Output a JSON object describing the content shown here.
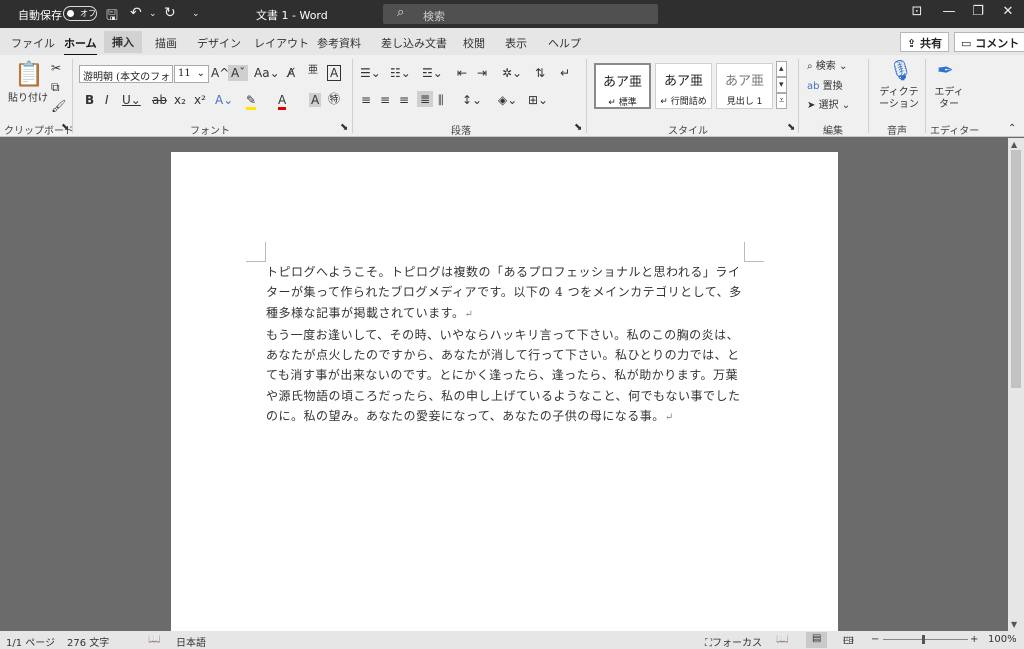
{
  "titlebar": {
    "autosave_label": "自動保存",
    "autosave_state": "オフ",
    "document_title": "文書 1  -  Word",
    "search_placeholder": "検索"
  },
  "tabs": [
    {
      "label": "ファイル"
    },
    {
      "label": "ホーム"
    },
    {
      "label": "挿入"
    },
    {
      "label": "描画"
    },
    {
      "label": "デザイン"
    },
    {
      "label": "レイアウト"
    },
    {
      "label": "参考資料"
    },
    {
      "label": "差し込み文書"
    },
    {
      "label": "校閲"
    },
    {
      "label": "表示"
    },
    {
      "label": "ヘルプ"
    }
  ],
  "tab_buttons": {
    "share": "共有",
    "comment": "コメント"
  },
  "ribbon": {
    "clipboard": {
      "group_label": "クリップボード",
      "paste_label": "貼り付け"
    },
    "font": {
      "group_label": "フォント",
      "font_name": "游明朝 (本文のフォ",
      "font_size": "11"
    },
    "paragraph": {
      "group_label": "段落"
    },
    "styles": {
      "group_label": "スタイル",
      "items": [
        {
          "preview": "あア亜",
          "name": "標準"
        },
        {
          "preview": "あア亜",
          "name": "行間詰め"
        },
        {
          "preview": "あア亜",
          "name": "見出し 1"
        }
      ]
    },
    "editing": {
      "group_label": "編集",
      "find": "検索",
      "replace": "置換",
      "select": "選択"
    },
    "voice": {
      "group_label": "音声",
      "dictate": "ディクテーション"
    },
    "editor": {
      "group_label": "エディター",
      "label": "エディター"
    }
  },
  "document": {
    "paragraphs": [
      "トピログへようこそ。トピログは複数の「あるプロフェッショナルと思われる」ライターが集って作られたブログメディアです。以下の 4 つをメインカテゴリとして、多種多様な記事が掲載されています。",
      "もう一度お逢いして、その時、いやならハッキリ言って下さい。私のこの胸の炎は、あなたが点火したのですから、あなたが消して行って下さい。私ひとりの力では、とても消す事が出来ないのです。とにかく逢ったら、逢ったら、私が助かります。万葉や源氏物語の頃ころだったら、私の申し上げているようなこと、何でもない事でしたのに。私の望み。あなたの愛妾になって、あなたの子供の母になる事。"
    ],
    "paragraph_mark": "↵"
  },
  "statusbar": {
    "page": "1/1 ページ",
    "words": "276 文字",
    "language": "日本語",
    "focus": "フォーカス",
    "zoom": "100%",
    "zoom_minus": "−",
    "zoom_plus": "+"
  }
}
